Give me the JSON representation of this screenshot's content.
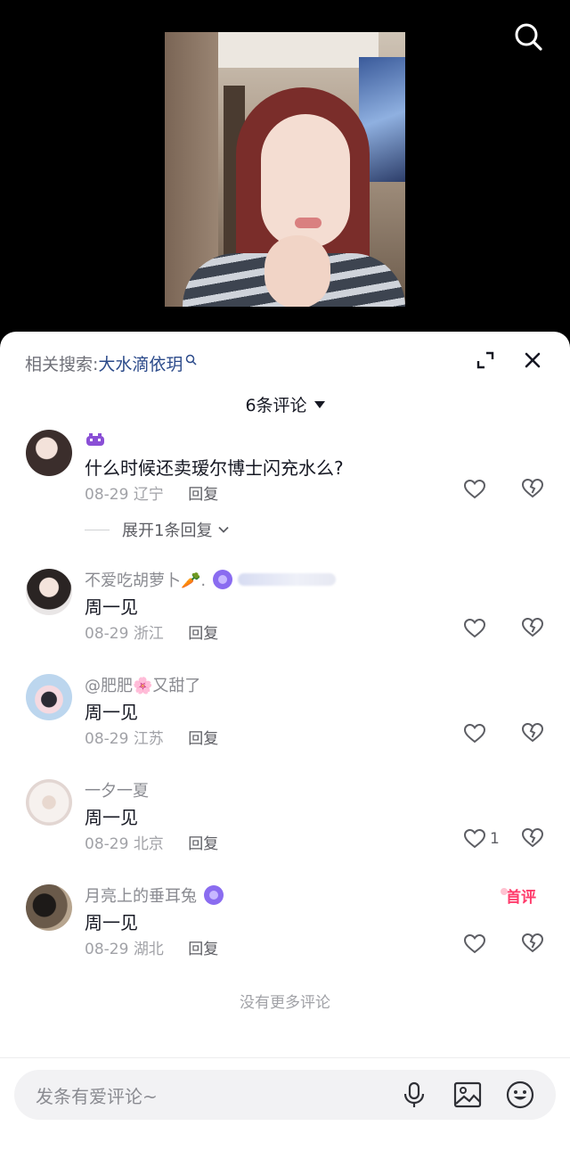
{
  "related_search": {
    "label": "相关搜索:",
    "term": "大水滴依玥"
  },
  "comment_count": "6条评论",
  "comments": [
    {
      "name": "",
      "text": "什么时候还卖瑷尔博士闪充水么?",
      "date": "08-29",
      "region": "辽宁",
      "reply": "回复",
      "likes": ""
    },
    {
      "name": "不爱吃胡萝卜🥕.",
      "text": "周一见",
      "date": "08-29",
      "region": "浙江",
      "reply": "回复",
      "likes": ""
    },
    {
      "name": "@肥肥🌸又甜了",
      "text": "周一见",
      "date": "08-29",
      "region": "江苏",
      "reply": "回复",
      "likes": ""
    },
    {
      "name": "一夕一夏",
      "text": "周一见",
      "date": "08-29",
      "region": "北京",
      "reply": "回复",
      "likes": "1"
    },
    {
      "name": "月亮上的垂耳兔",
      "text": "周一见",
      "date": "08-29",
      "region": "湖北",
      "reply": "回复",
      "likes": "",
      "tag": "首评"
    }
  ],
  "expand_replies": "展开1条回复",
  "no_more": "没有更多评论",
  "input": {
    "placeholder": "发条有爱评论~"
  },
  "icons": {
    "search": "search-icon",
    "expand": "expand-icon",
    "close": "close-icon",
    "like": "heart-icon",
    "dislike": "broken-heart-icon",
    "mic": "mic-icon",
    "image": "image-icon",
    "emoji": "emoji-icon"
  },
  "colors": {
    "accent_link": "#2b4a8a",
    "first_tag": "#ff3b6b",
    "level_badge": "#8a6cf0"
  }
}
